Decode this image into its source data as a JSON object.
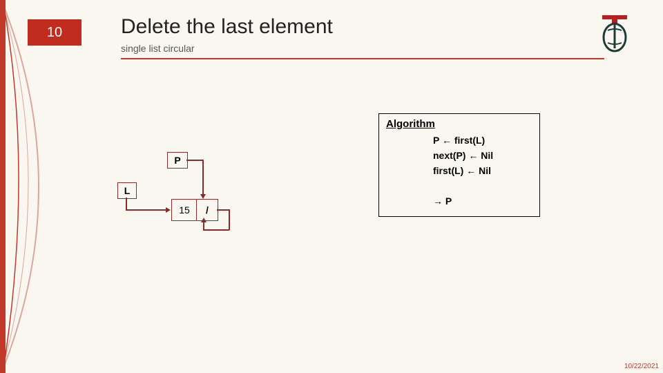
{
  "slide_number": "10",
  "title": "Delete the last element",
  "subtitle": "single list circular",
  "date": "10/22/2021",
  "algorithm": {
    "heading": "Algorithm",
    "line1": "P ← first(L)",
    "line2": "next(P) ← Nil",
    "line3": "first(L) ← Nil",
    "return": "→ P"
  },
  "diagram": {
    "pointer_P": "P",
    "list_L": "L",
    "node_value": "15",
    "node_next": "/"
  },
  "colors": {
    "accent": "#c0392b",
    "diagram_stroke": "#8b2a2a",
    "background": "#faf7f0"
  }
}
